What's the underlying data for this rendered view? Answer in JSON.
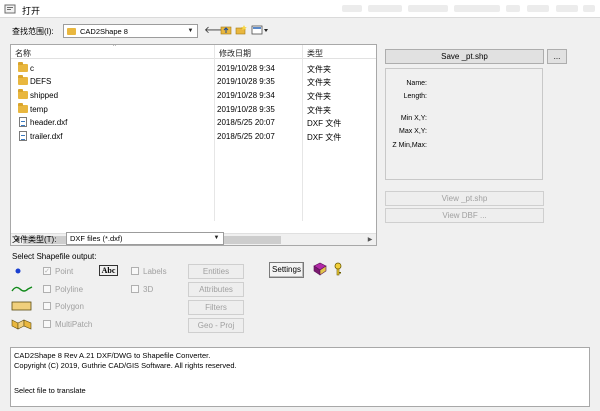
{
  "window": {
    "title": "打开"
  },
  "lookin": {
    "label": "查找范围(I):",
    "value": "CAD2Shape 8"
  },
  "toolbar": {
    "back_icon": "back-arrow-icon",
    "up_icon": "up-folder-icon",
    "newfolder_icon": "new-folder-icon",
    "view_icon": "view-menu-icon"
  },
  "filelist": {
    "columns": {
      "name": "名称",
      "date": "修改日期",
      "type": "类型"
    },
    "rows": [
      {
        "name": "c",
        "date": "2019/10/28 9:34",
        "type": "文件夹",
        "icon": "folder-icon"
      },
      {
        "name": "DEFS",
        "date": "2019/10/28 9:35",
        "type": "文件夹",
        "icon": "folder-icon"
      },
      {
        "name": "shipped",
        "date": "2019/10/28 9:34",
        "type": "文件夹",
        "icon": "folder-icon"
      },
      {
        "name": "temp",
        "date": "2019/10/28 9:35",
        "type": "文件夹",
        "icon": "folder-icon"
      },
      {
        "name": "header.dxf",
        "date": "2018/5/25 20:07",
        "type": "DXF 文件",
        "icon": "dxf-file-icon"
      },
      {
        "name": "trailer.dxf",
        "date": "2018/5/25 20:07",
        "type": "DXF 文件",
        "icon": "dxf-file-icon"
      }
    ]
  },
  "filetype": {
    "label": "文件类型(T):",
    "value": "DXF files (*.dxf)"
  },
  "right": {
    "save_button": "Save _pt.shp",
    "browse_button": "...",
    "info": {
      "name": "Name:",
      "length": "Length:",
      "minxy": "Min X,Y:",
      "maxxy": "Max X,Y:",
      "zminmax": "Z Min,Max:"
    },
    "view_pt_button": "View _pt.shp",
    "view_dbf_button": "View DBF ..."
  },
  "shapefile": {
    "heading": "Select Shapefile output:",
    "point": "Point",
    "polyline": "Polyline",
    "polygon": "Polygon",
    "multipatch": "MultiPatch",
    "labels": "Labels",
    "threed": "3D",
    "abc_icon_text": "Abc",
    "entities_button": "Entities",
    "attributes_button": "Attributes",
    "filters_button": "Filters",
    "geoproj_button": "Geo - Proj",
    "settings_button": "Settings"
  },
  "status": {
    "line1": "CAD2Shape 8 Rev A.21 DXF/DWG to Shapefile Converter.",
    "line2": "Copyright (C) 2019, Guthrie CAD/GIS Software. All rights reserved.",
    "line3": "Select file to translate"
  }
}
